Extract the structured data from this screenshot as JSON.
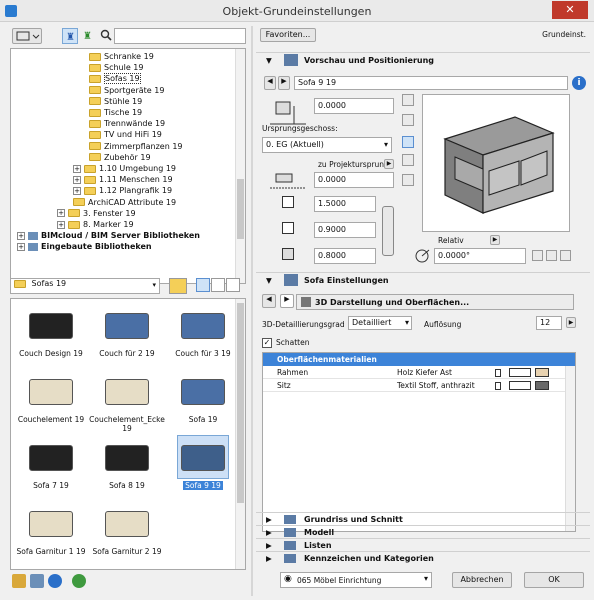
{
  "window": {
    "title": "Objekt-Grundeinstellungen",
    "close_icon": "✕"
  },
  "left": {
    "search_value": "",
    "tree": [
      {
        "label": "Schranke 19",
        "type": "folder"
      },
      {
        "label": "Schule 19",
        "type": "folder"
      },
      {
        "label": "Sofas 19",
        "type": "folder",
        "selected": true
      },
      {
        "label": "Sportgeräte 19",
        "type": "folder"
      },
      {
        "label": "Stühle 19",
        "type": "folder"
      },
      {
        "label": "Tische 19",
        "type": "folder"
      },
      {
        "label": "Trennwände 19",
        "type": "folder"
      },
      {
        "label": "TV und HiFi 19",
        "type": "folder"
      },
      {
        "label": "Zimmerpflanzen 19",
        "type": "folder"
      },
      {
        "label": "Zubehör 19",
        "type": "folder"
      },
      {
        "label": "1.10 Umgebung 19",
        "type": "folder",
        "expand": "+"
      },
      {
        "label": "1.11 Menschen 19",
        "type": "folder",
        "expand": "+"
      },
      {
        "label": "1.12 Plangrafik 19",
        "type": "folder",
        "expand": "+"
      },
      {
        "label": "ArchiCAD Attribute 19",
        "type": "folder"
      },
      {
        "label": "3. Fenster 19",
        "type": "folder",
        "expand": "+"
      },
      {
        "label": "8. Marker 19",
        "type": "folder",
        "expand": "+"
      },
      {
        "label": "BIMcloud / BIM Server Bibliotheken",
        "type": "bold",
        "expand": "+"
      },
      {
        "label": "Eingebaute Bibliotheken",
        "type": "bold",
        "expand": "+"
      }
    ],
    "folder_dropdown": "Sofas 19",
    "thumbnails": [
      {
        "label": "Couch Design 19"
      },
      {
        "label": "Couch für 2 19"
      },
      {
        "label": "Couch für 3 19"
      },
      {
        "label": "Couchelement 19"
      },
      {
        "label": "Couchelement_Ecke 19"
      },
      {
        "label": "Sofa 19"
      },
      {
        "label": "Sofa 7 19"
      },
      {
        "label": "Sofa 8 19"
      },
      {
        "label": "Sofa 9 19",
        "selected": true
      },
      {
        "label": "Sofa Garnitur 1 19"
      },
      {
        "label": "Sofa Garnitur 2 19"
      }
    ]
  },
  "right": {
    "favorites_button": "Favoriten...",
    "header_right": "Grundeinst.",
    "preview_section": "Vorschau und Positionierung",
    "object_name": "Sofa 9 19",
    "elevation_value": "0.0000",
    "origin_floor_label": "Ursprungsgeschoss:",
    "origin_floor_value": "0. EG (Aktuell)",
    "project_origin_label": "zu Projektursprung",
    "project_origin_value": "0.0000",
    "dim_a": "1.5000",
    "dim_b": "0.9000",
    "dim_c": "0.8000",
    "relative_label": "Relativ",
    "angle_value": "0.0000°",
    "sofa_section": "Sofa Einstellungen",
    "page_title": "3D Darstellung und Oberflächen...",
    "detail_label": "3D-Detaillierungsgrad",
    "detail_value": "Detailliert",
    "resolution_label": "Auflösung",
    "resolution_value": "12",
    "shadow_label": "Schatten",
    "shadow_checked": true,
    "surfaces_header": "Oberflächenmaterialien",
    "surfaces": [
      {
        "name": "Rahmen",
        "material": "Holz Kiefer Ast",
        "color": "#e8d2b0"
      },
      {
        "name": "Sitz",
        "material": "Textil Stoff, anthrazit",
        "color": "#6a6a6a"
      }
    ],
    "collapsed_sections": [
      "Grundriss und Schnitt",
      "Modell",
      "Listen",
      "Kennzeichen und Kategorien"
    ],
    "layer_value": "065 Möbel Einrichtung",
    "cancel_button": "Abbrechen",
    "ok_button": "OK"
  }
}
